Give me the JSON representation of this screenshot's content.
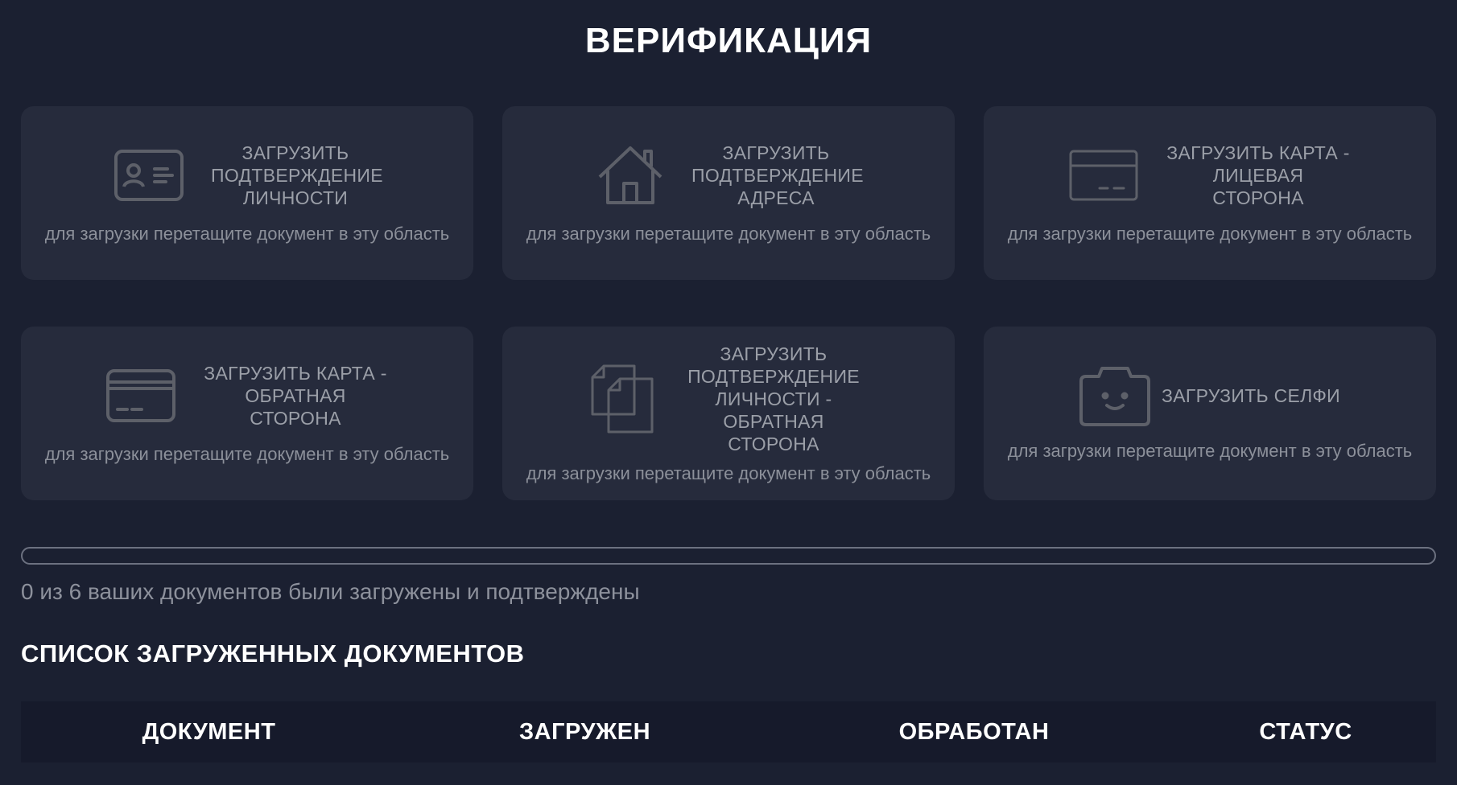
{
  "page": {
    "title": "ВЕРИФИКАЦИЯ"
  },
  "cards": [
    {
      "icon": "id-card-icon",
      "label": "Загрузить подтверждение личности",
      "hint": "для загрузки перетащите документ в эту область"
    },
    {
      "icon": "house-icon",
      "label": "Загрузить подтверждение адреса",
      "hint": "для загрузки перетащите документ в эту область"
    },
    {
      "icon": "credit-card-front-icon",
      "label": "Загрузить карта - лицевая сторона",
      "hint": "для загрузки перетащите документ в эту область"
    },
    {
      "icon": "credit-card-back-icon",
      "label": "Загрузить карта - обратная сторона",
      "hint": "для загрузки перетащите документ в эту область"
    },
    {
      "icon": "documents-icon",
      "label": "Загрузить подтверждение личности - обратная сторона",
      "hint": "для загрузки перетащите документ в эту область"
    },
    {
      "icon": "selfie-camera-icon",
      "label": "Загрузить селфи",
      "hint": "для загрузки перетащите документ в эту область"
    }
  ],
  "progress": {
    "fraction": 0,
    "text": "0 из 6 ваших документов были загружены и подтверждены"
  },
  "documents": {
    "title": "СПИСОК ЗАГРУЖЕННЫХ ДОКУМЕНТОВ",
    "columns": [
      "ДОКУМЕНТ",
      "ЗАГРУЖЕН",
      "ОБРАБОТАН",
      "СТАТУС"
    ]
  },
  "colors": {
    "background": "#1b2031",
    "card": "#262b3c",
    "icon_stroke": "#5d6069",
    "table_header": "#161a2b"
  }
}
